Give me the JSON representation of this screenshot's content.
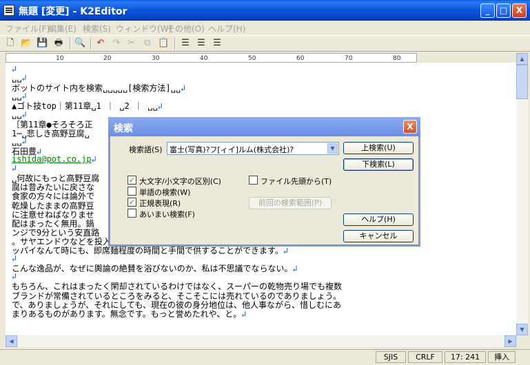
{
  "window": {
    "title": "無題 [変更] - K2Editor",
    "minimize": "_",
    "maximize": "□",
    "close": "X"
  },
  "menu": [
    "ファイル(F)",
    "編集(E)",
    "検索(S)",
    "ウィンドウ(W)",
    "その他(O)",
    "ヘルプ(H)"
  ],
  "ruler": [
    "10",
    "20",
    "30",
    "40",
    "50",
    "60",
    "70",
    "80"
  ],
  "editor_lines": [
    {
      "text": "",
      "mark": "↲"
    },
    {
      "text": "␣␣",
      "mark": "↲"
    },
    {
      "text": "ボットのサイト内を検索␣␣␣␣␣[検索方法]␣␣",
      "mark": "↲"
    },
    {
      "text": "␣␣",
      "mark": "↲"
    },
    {
      "text": "▲ゴト技top｜第11章␣1 ｜ ␣2 ｜ ␣␣",
      "mark": "↲"
    },
    {
      "text": "␣␣",
      "mark": "↲"
    },
    {
      "text": "［第11章●そろそろ正",
      "mark": ""
    },
    {
      "text": "1⋯␣悲しき高野豆腐␣",
      "mark": ""
    },
    {
      "text": "␣␣",
      "mark": "↲"
    },
    {
      "text": "石田豊",
      "mark": "↲"
    },
    {
      "text": "ishida@pot.co.jp",
      "mark": "↲",
      "link": true
    },
    {
      "text": "",
      "mark": "↲"
    },
    {
      "text": "␣何故にもっと高野豆腐",
      "mark": ""
    },
    {
      "text": "腐は昔みたいに戻さな",
      "mark": ""
    },
    {
      "text": "食家の方々には論外で",
      "mark": ""
    },
    {
      "text": "乾燥したままの高野豆",
      "mark": ""
    },
    {
      "text": "に注意せねばなりませ",
      "mark": ""
    },
    {
      "text": "配はまったく無用。鍋",
      "mark": ""
    },
    {
      "text": "ンジで9分という安直路",
      "mark": ""
    },
    {
      "text": "。サヤエンドウなどを投入すれば小粋な一皿になり上がるし、突然の来客で、まあまあイ",
      "mark": ""
    },
    {
      "text": "ッパイなんて時にも、即席麺程度の時間と手間で供することができます。",
      "mark": "↲"
    },
    {
      "text": "",
      "mark": "↲"
    },
    {
      "text": "こんな逸品が、なぜに輿論の絶賛を浴びないのか、私は不思議でならない。",
      "mark": "↲"
    },
    {
      "text": "",
      "mark": "↲"
    },
    {
      "text": "もちろん、これはまったく閑却されているわけではなく、スーパーの乾物売り場でも複数",
      "mark": ""
    },
    {
      "text": "ブランドが常備されているところをみると、そこそこには売れているのでありましょう。",
      "mark": ""
    },
    {
      "text": "で、ありましょうが、それにしても、現在の彼の身分地位は、他人事ながら、惜しむにあ",
      "mark": ""
    },
    {
      "text": "まりあるものがあります。無念です。もっと誉めたれや、と。",
      "mark": "↲"
    }
  ],
  "status": {
    "encoding": "SJIS",
    "newline": "CRLF",
    "position": "17: 241",
    "mode": "挿入"
  },
  "dialog": {
    "title": "検索",
    "close": "X",
    "search_label": "検索語(S)",
    "search_value": "富士(写真)?フ[ィイ]ルム(株式会社)?",
    "btn_search_up": "上検索(U)",
    "btn_search_down": "下検索(L)",
    "btn_prev_range": "前回の検索範囲(P)",
    "btn_help": "ヘルプ(H)",
    "btn_cancel": "キャンセル",
    "options": {
      "case_sensitive": {
        "label": "大文字/小文字の区別(C)",
        "checked": true
      },
      "whole_word": {
        "label": "単語の検索(W)",
        "checked": false
      },
      "regex": {
        "label": "正規表現(R)",
        "checked": true
      },
      "fuzzy": {
        "label": "あいまい検索(F)",
        "checked": false
      },
      "from_top": {
        "label": "ファイル先頭から(T)",
        "checked": false
      }
    }
  }
}
